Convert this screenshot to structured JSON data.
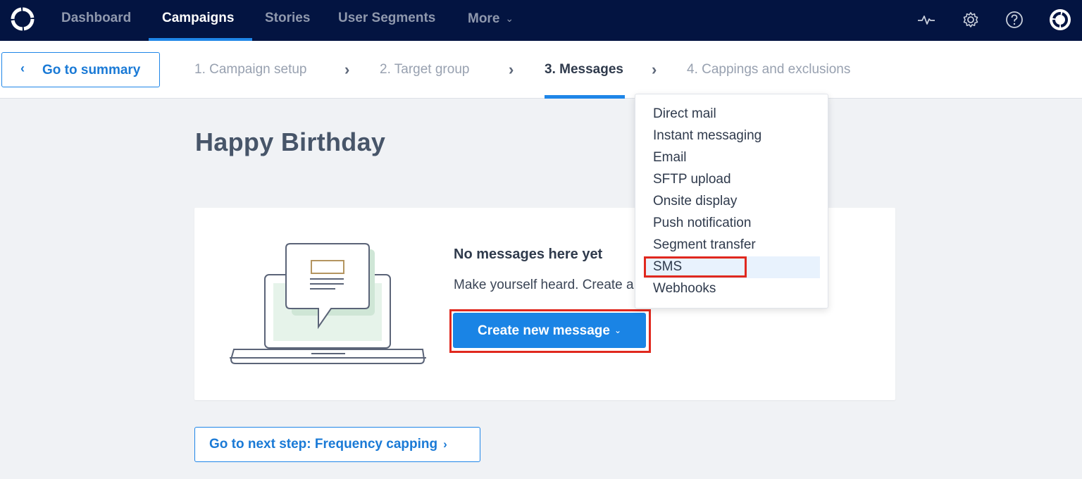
{
  "nav": {
    "items": [
      {
        "label": "Dashboard",
        "active": false
      },
      {
        "label": "Campaigns",
        "active": true
      },
      {
        "label": "Stories",
        "active": false
      },
      {
        "label": "User Segments",
        "active": false
      },
      {
        "label": "More",
        "active": false
      }
    ],
    "icons": [
      "activity-icon",
      "gear-icon",
      "help-icon",
      "user-avatar-icon"
    ]
  },
  "stepbar": {
    "back_label": "Go to summary",
    "steps": [
      {
        "label": "1. Campaign setup",
        "active": false
      },
      {
        "label": "2. Target group",
        "active": false
      },
      {
        "label": "3. Messages",
        "active": true
      },
      {
        "label": "4. Cappings and exclusions",
        "active": false
      }
    ]
  },
  "page": {
    "title": "Happy Birthday"
  },
  "empty_state": {
    "title": "No messages here yet",
    "text": "Make yourself heard. Create a",
    "create_button": "Create new message"
  },
  "next_button": "Go to next step: Frequency capping",
  "dropdown": {
    "items": [
      "Direct mail",
      "Instant messaging",
      "Email",
      "SFTP upload",
      "Onsite display",
      "Push notification",
      "Segment transfer",
      "SMS",
      "Webhooks"
    ],
    "highlighted": "SMS"
  },
  "colors": {
    "nav_bg": "#031441",
    "accent": "#1a84e5",
    "highlight_red": "#e0281e"
  }
}
